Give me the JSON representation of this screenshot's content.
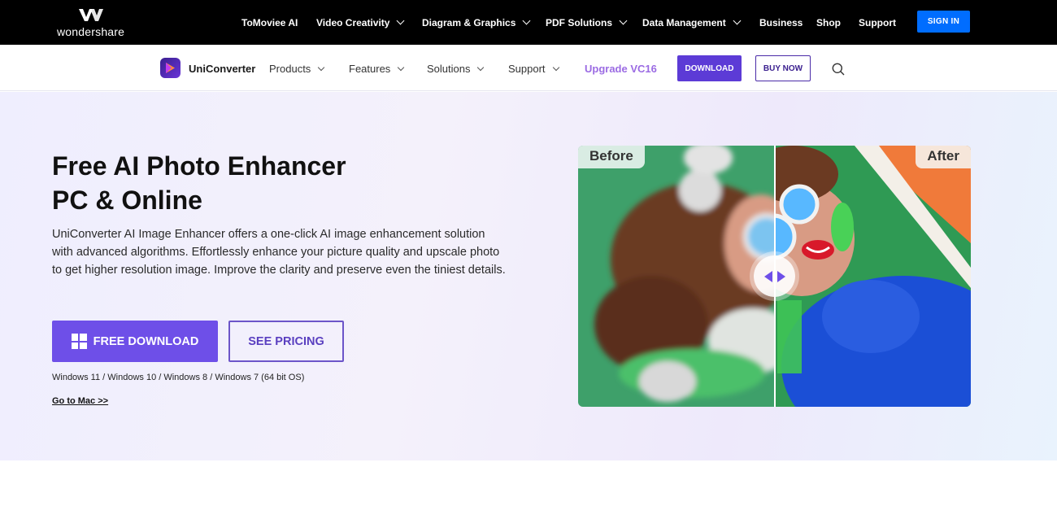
{
  "topbar": {
    "brand": "wondershare",
    "nav": [
      {
        "label": "ToMoviee AI",
        "dropdown": false
      },
      {
        "label": "Video Creativity",
        "dropdown": true
      },
      {
        "label": "Diagram & Graphics",
        "dropdown": true
      },
      {
        "label": "PDF Solutions",
        "dropdown": true
      },
      {
        "label": "Data Management",
        "dropdown": true
      },
      {
        "label": "Business",
        "dropdown": false
      },
      {
        "label": "Shop",
        "dropdown": false
      },
      {
        "label": "Support",
        "dropdown": false
      }
    ],
    "signin": "SIGN IN"
  },
  "subnav": {
    "product_name": "UniConverter",
    "items": [
      {
        "label": "Products"
      },
      {
        "label": "Features"
      },
      {
        "label": "Solutions"
      },
      {
        "label": "Support"
      }
    ],
    "upgrade": "Upgrade VC16",
    "download": "DOWNLOAD",
    "buy_now": "BUY NOW"
  },
  "hero": {
    "title_line1": "Free AI Photo Enhancer",
    "title_line2": "PC & Online",
    "description": "UniConverter AI Image Enhancer offers a one-click AI image enhancement solution with advanced algorithms. Effortlessly enhance your picture quality and upscale photo to get higher resolution image. Improve the clarity and preserve even the tiniest details.",
    "free_download": "FREE DOWNLOAD",
    "see_pricing": "SEE PRICING",
    "os_note": "Windows 11 / Windows 10 / Windows 8 / Windows 7 (64 bit OS)",
    "mac_link": "Go to Mac >>"
  },
  "compare": {
    "before_label": "Before",
    "after_label": "After",
    "accent_color": "#6e4fe8"
  },
  "colors": {
    "topbar_bg": "#000000",
    "signin_bg": "#006dff",
    "brand_purple": "#5c3bd6",
    "upgrade_text": "#9b6be3"
  }
}
